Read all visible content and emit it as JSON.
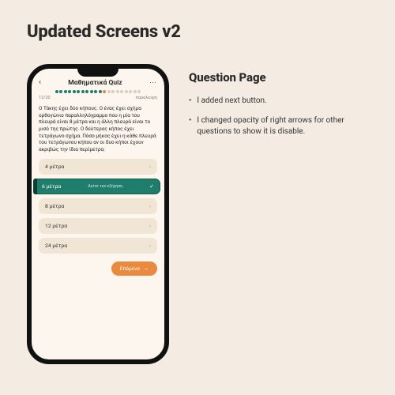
{
  "page": {
    "title": "Updated Screens v2"
  },
  "section": {
    "heading": "Question Page"
  },
  "notes": {
    "items": [
      "I added next button.",
      "I changed opacity of right arrows for other questions to show it is disable."
    ]
  },
  "phone": {
    "quiz_title": "Μαθηματικά Quiz",
    "counter": "12/20",
    "skip_label": "παραλειψη",
    "question": "Ο Τάκης έχει δύο κήπους. Ο ένας έχει σχήμα ορθογώνιο παραλληλόγραμμο που η μία του πλευρά είναι 8 μέτρα και η άλλη πλευρά είναι το μισό της πρώτης. Ο δεύτερος κήπος έχει τετράγωνο σχήμα. Πόσο μήκος έχει η κάθε πλευρά του τετράγωνου κήπου αν οι δυο κήποι έχουν ακριβώς την ίδια περίμετρο;",
    "answers": [
      {
        "label": "4 μέτρα",
        "selected": false
      },
      {
        "label": "6 μέτρα",
        "selected": true,
        "sublabel": "Δείτε την εξήγηση"
      },
      {
        "label": "8 μέτρα",
        "selected": false
      },
      {
        "label": "12 μέτρα",
        "selected": false
      },
      {
        "label": "24 μέτρα",
        "selected": false
      }
    ],
    "next_label": "Επόμενο",
    "progress": {
      "done": 11,
      "current": 1,
      "todo": 8
    }
  },
  "colors": {
    "accent_green": "#1f7d6b",
    "accent_orange": "#e98a3f",
    "card_bg": "#f1e6d6",
    "page_bg": "#f4ece2",
    "screen_bg": "#fcf6ee"
  }
}
